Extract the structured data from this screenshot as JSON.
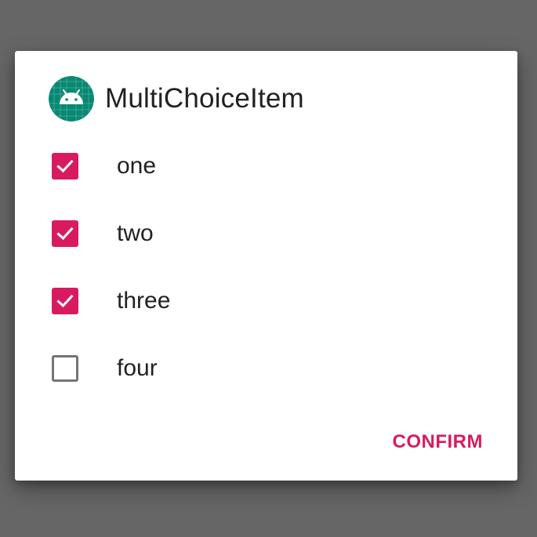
{
  "dialog": {
    "title": "MultiChoiceItem",
    "app_icon": "android-robot-icon",
    "items": [
      {
        "label": "one",
        "checked": true
      },
      {
        "label": "two",
        "checked": true
      },
      {
        "label": "three",
        "checked": true
      },
      {
        "label": "four",
        "checked": false
      }
    ],
    "confirm_label": "CONFIRM"
  },
  "colors": {
    "scrim": "#666666",
    "accent": "#d81b60",
    "icon_background": "#078873",
    "text": "#212121",
    "unchecked_border": "#757575"
  }
}
